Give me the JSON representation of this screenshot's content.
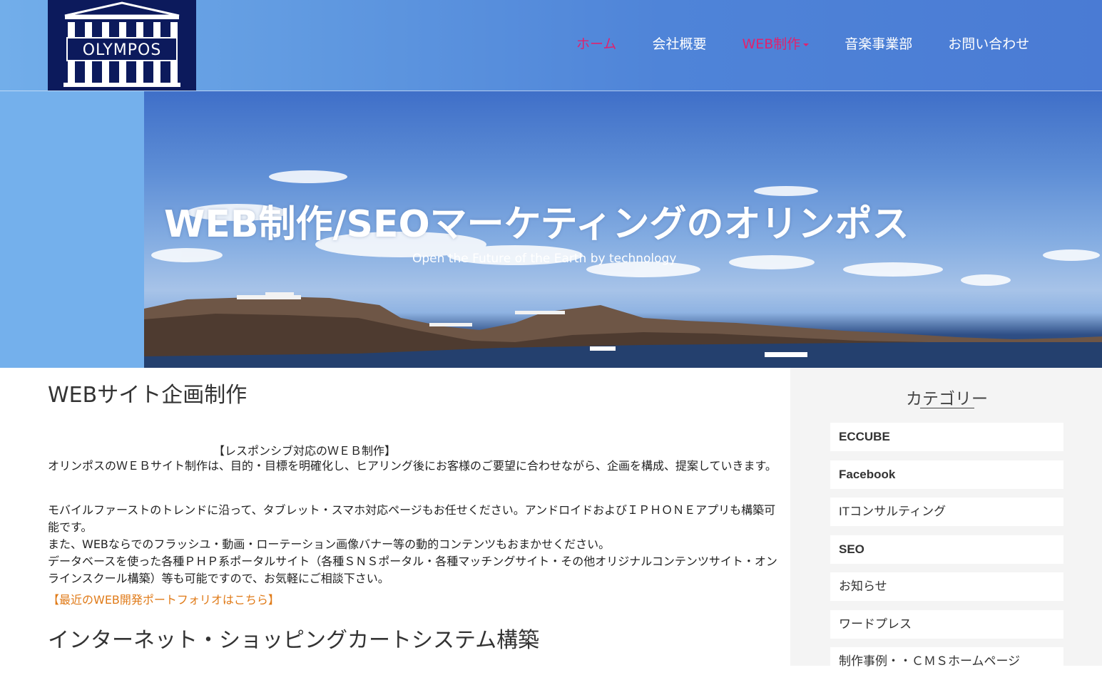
{
  "logo": {
    "text": "OLYMPOS"
  },
  "nav": {
    "items": [
      {
        "label": "ホーム"
      },
      {
        "label": "会社概要"
      },
      {
        "label": "WEB制作"
      },
      {
        "label": "音楽事業部"
      },
      {
        "label": "お問い合わせ"
      }
    ]
  },
  "hero": {
    "title": "WEB制作/SEOマーケティングのオリンポス",
    "subtitle": "Open the Future of the Earth by technology"
  },
  "main": {
    "section1_title": "WEBサイト企画制作",
    "subhead": "【レスポンシブ対応のＷＥＢ制作】",
    "para1": "オリンポスのＷＥＢサイト制作は、目的・目標を明確化し、ヒアリング後にお客様のご要望に合わせながら、企画を構成、提案していきます。",
    "para2_line1": "モバイルファーストのトレンドに沿って、タブレット・スマホ対応ページもお任せください。アンドロイドおよびＩＰＨＯＮＥアプリも構築可能です。",
    "para2_line2": "また、WEBならでのフラッシユ・動画・ローテーション画像バナー等の動的コンテンツもおまかせください。",
    "para2_line3": "データベースを使った各種ＰＨＰ系ポータルサイト（各種ＳＮＳポータル・各種マッチングサイト・その他オリジナルコンテンツサイト・オンラインスクール構築）等も可能ですので、お気軽にご相談下さい。",
    "portfolio_link": "【最近のWEB開発ポートフォリオはこちら】",
    "section2_title": "インターネット・ショッピングカートシステム構築"
  },
  "sidebar": {
    "title": "カテゴリー",
    "categories": [
      {
        "label": "ECCUBE"
      },
      {
        "label": "Facebook"
      },
      {
        "label": "ITコンサルティング"
      },
      {
        "label": "SEO"
      },
      {
        "label": "お知らせ"
      },
      {
        "label": "ワードプレス"
      },
      {
        "label": "制作事例・・ＣＭＳホームページ"
      }
    ]
  },
  "colors": {
    "accent_pink": "#e0226e",
    "link_orange": "#e07b19",
    "logo_navy": "#0c1a5c"
  }
}
